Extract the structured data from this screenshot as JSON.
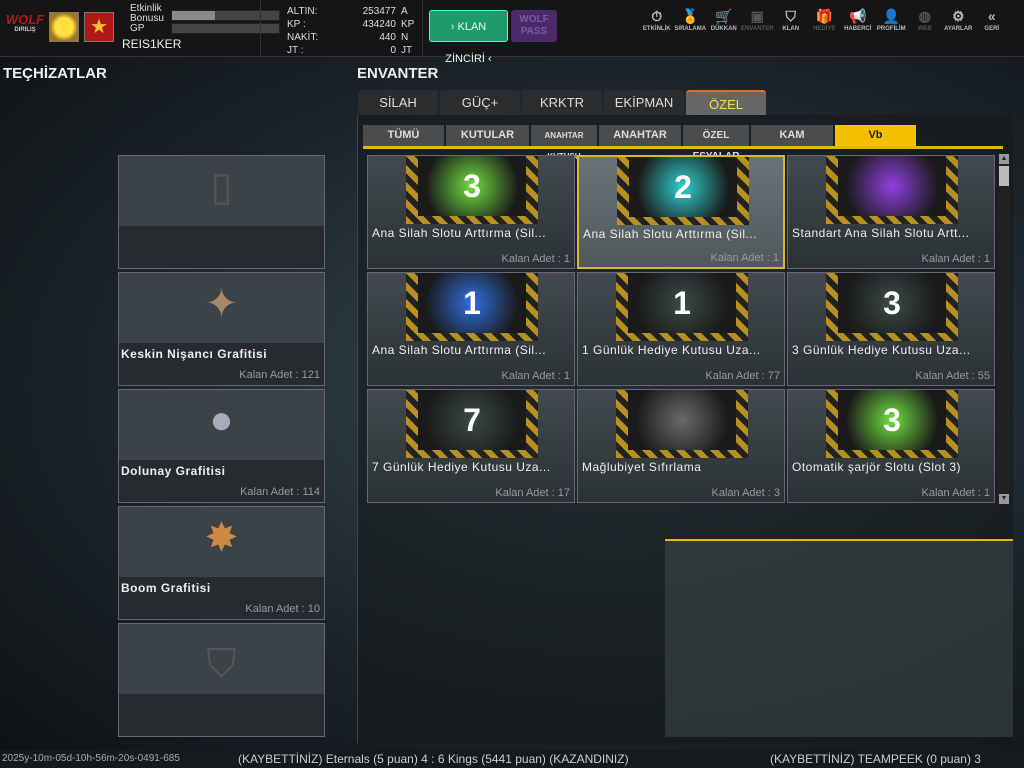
{
  "header": {
    "logo": "WOLF",
    "logo_sub": "DIRILIŞ",
    "event_bonus_label": "Etkinlik Bonusu",
    "event_bonus_progress": 0.4,
    "gp_label": "GP",
    "gp_progress": 0,
    "username": "REIS1KER",
    "currencies": [
      {
        "label": "ALTIN:",
        "value": "253477",
        "unit": "A"
      },
      {
        "label": "KP :",
        "value": "434240",
        "unit": "KP"
      },
      {
        "label": "NAKİT:",
        "value": "440",
        "unit": "N"
      },
      {
        "label": "JT :",
        "value": "0",
        "unit": "JT"
      }
    ],
    "klan_button": "› KLAN ZİNCİRİ ‹",
    "wolf_pass_button": "WOLF PASS",
    "nav": [
      {
        "label": "ETKİNLİK",
        "icon": "stopwatch-icon"
      },
      {
        "label": "SIRALAMA",
        "icon": "medal-icon"
      },
      {
        "label": "DÜKKAN",
        "icon": "cart-icon"
      },
      {
        "label": "ENVANTER",
        "icon": "inventory-icon"
      },
      {
        "label": "KLAN",
        "icon": "shield-icon"
      },
      {
        "label": "HEDİYE",
        "icon": "gift-icon"
      },
      {
        "label": "HABERCİ",
        "icon": "megaphone-icon"
      },
      {
        "label": "PROFİLİM",
        "icon": "profile-icon"
      },
      {
        "label": "WEB",
        "icon": "globe-icon"
      },
      {
        "label": "AYARLAR",
        "icon": "gear-icon"
      },
      {
        "label": "GERİ",
        "icon": "back-icon"
      }
    ]
  },
  "equipment": {
    "title": "TEÇHİZATLAR",
    "slots": [
      {
        "name": "",
        "count": ""
      },
      {
        "name": "Keskin Nişancı Grafitisi",
        "count": "Kalan Adet : 121"
      },
      {
        "name": "Dolunay Grafitisi",
        "count": "Kalan Adet : 114"
      },
      {
        "name": "Boom Grafitisi",
        "count": "Kalan Adet : 10"
      },
      {
        "name": "",
        "count": ""
      }
    ]
  },
  "inventory": {
    "title": "ENVANTER",
    "tabs": [
      "SİLAH",
      "GÜÇ+",
      "KRKTR",
      "EKİPMAN",
      "ÖZEL"
    ],
    "active_tab": "ÖZEL",
    "subtabs": [
      "TÜMÜ",
      "KUTULAR",
      "ANAHTAR KUTUSU",
      "ANAHTAR",
      "ÖZEL EŞYALAR",
      "KAM",
      "Vb"
    ],
    "active_subtab": "Vb",
    "items": [
      {
        "name": "Ana Silah Slotu Arttırma (Sil...",
        "count": "Kalan Adet : 1",
        "badge": "3",
        "color": "#70e040"
      },
      {
        "name": "Ana Silah Slotu Arttırma (Sil...",
        "count": "Kalan Adet : 1",
        "badge": "2",
        "color": "#30d0d0"
      },
      {
        "name": "Standart Ana Silah Slotu Artt...",
        "count": "Kalan Adet : 1",
        "badge": "",
        "color": "#9040e0"
      },
      {
        "name": "Ana Silah Slotu Arttırma (Sil...",
        "count": "Kalan Adet : 1",
        "badge": "1",
        "color": "#3070e0"
      },
      {
        "name": "1 Günlük Hediye Kutusu Uza...",
        "count": "Kalan Adet : 77",
        "badge": "1",
        "color": "#3a4a48"
      },
      {
        "name": "3 Günlük Hediye Kutusu Uza...",
        "count": "Kalan Adet : 55",
        "badge": "3",
        "color": "#3a4a48"
      },
      {
        "name": "7 Günlük Hediye Kutusu Uza...",
        "count": "Kalan Adet : 17",
        "badge": "7",
        "color": "#3a4a48"
      },
      {
        "name": "Mağlubiyet  Sıfırlama",
        "count": "Kalan Adet : 3",
        "badge": "",
        "color": "#6a6a6a"
      },
      {
        "name": "Otomatik şarjör Slotu (Slot 3)",
        "count": "Kalan Adet : 1",
        "badge": "3",
        "color": "#70e040"
      }
    ]
  },
  "ticker": {
    "timestamp": "2025y-10m-05d-10h-56m-20s-0491-685",
    "messages": [
      "(KAYBETTİNİZ) Eternals (5 puan) 4 : 6 Kings (5441 puan) (KAZANDINIZ)",
      "(KAYBETTİNİZ) TEAMPEEK (0 puan) 3"
    ]
  }
}
